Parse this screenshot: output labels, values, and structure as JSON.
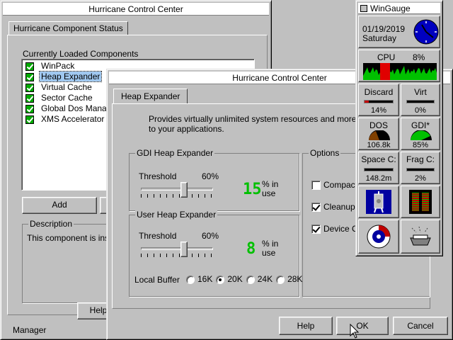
{
  "back_window": {
    "title": "Hurricane Control Center",
    "tab": "Hurricane Component Status",
    "list_label": "Currently Loaded Components",
    "components": [
      {
        "label": "WinPack",
        "selected": false
      },
      {
        "label": "Heap Expander",
        "selected": true
      },
      {
        "label": "Virtual Cache",
        "selected": false
      },
      {
        "label": "Sector Cache",
        "selected": false
      },
      {
        "label": "Global Dos Manage",
        "selected": false
      },
      {
        "label": "XMS Accelerator",
        "selected": false
      }
    ],
    "add_button": "Add",
    "description_label": "Description",
    "description_text": "This component is insta",
    "help_button": "Help",
    "status_text": "Manager"
  },
  "front_window": {
    "title": "Hurricane Control Center",
    "tab": "Heap Expander",
    "description": "Provides virtually unlimited system resources and more availab",
    "description2": "to your applications.",
    "gdi": {
      "title": "GDI Heap Expander",
      "threshold_label": "Threshold",
      "threshold_value": "60%",
      "threshold_fraction": 0.6,
      "use_value": "15",
      "use_unit": "% in",
      "use_unit2": "use"
    },
    "user": {
      "title": "User Heap Expander",
      "threshold_label": "Threshold",
      "threshold_value": "60%",
      "threshold_fraction": 0.6,
      "use_value": "8",
      "use_unit": "% in",
      "use_unit2": "use"
    },
    "local_buffer": {
      "label": "Local Buffer",
      "options": [
        "16K",
        "20K",
        "24K",
        "28K"
      ],
      "selected": "20K"
    },
    "options": {
      "title": "Options",
      "items": [
        {
          "label": "Compact",
          "checked": false
        },
        {
          "label": "Cleanup C",
          "checked": true
        },
        {
          "label": "Device Ce",
          "checked": true
        }
      ]
    },
    "help_button": "Help",
    "ok_button": "OK",
    "cancel_button": "Cancel"
  },
  "wingauge": {
    "title": "WinGauge",
    "date": "01/19/2019",
    "day": "Saturday",
    "cpu_label": "CPU",
    "cpu_value": "8%",
    "discard_label": "Discard",
    "discard_value": "14%",
    "discard_fraction": 0.14,
    "virt_label": "Virt",
    "virt_value": "0%",
    "virt_fraction": 0.0,
    "dos_label": "DOS",
    "dos_value": "106.8k",
    "gdi_label": "GDI*",
    "gdi_value": "85%",
    "space_label": "Space C:",
    "space_value": "148.2m",
    "frag_label": "Frag C:",
    "frag_value": "2%",
    "colors": {
      "clock_face": "#0000c0",
      "cpu_graph": "#00c000",
      "cpu_peak": "#e00000",
      "lcd": "#00c000"
    }
  }
}
